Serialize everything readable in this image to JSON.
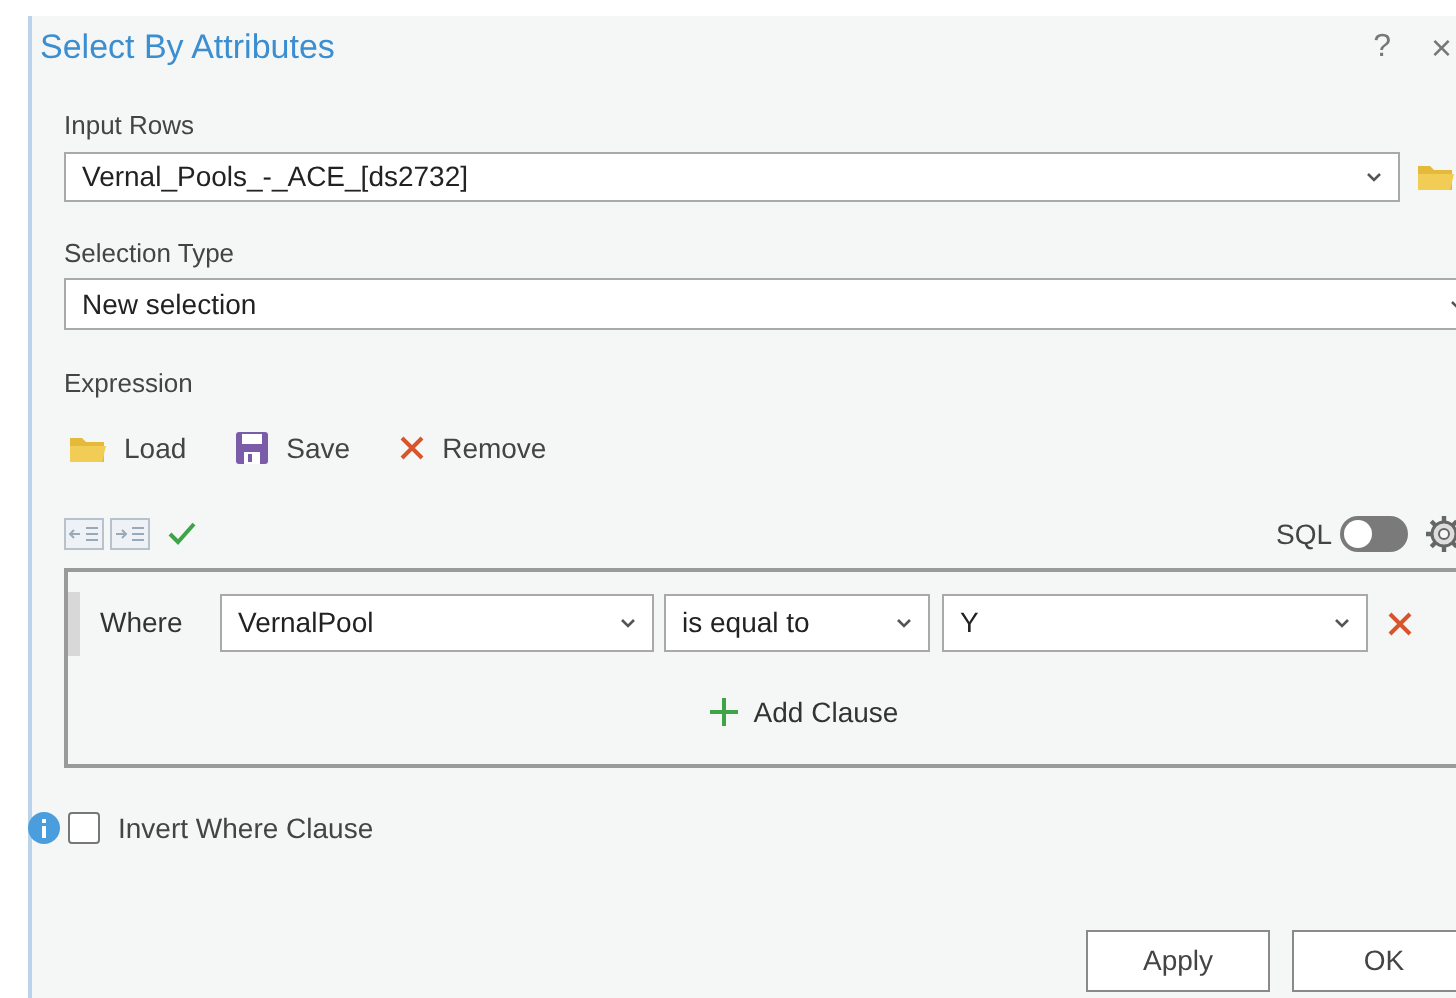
{
  "dialog": {
    "title": "Select By Attributes",
    "help": "?",
    "close": "×"
  },
  "input_rows": {
    "label": "Input Rows",
    "value": "Vernal_Pools_-_ACE_[ds2732]"
  },
  "selection_type": {
    "label": "Selection Type",
    "value": "New selection"
  },
  "expression": {
    "label": "Expression",
    "actions": [
      {
        "kind": "load",
        "label": "Load"
      },
      {
        "kind": "save",
        "label": "Save"
      },
      {
        "kind": "remove",
        "label": "Remove"
      }
    ],
    "sql": {
      "label": "SQL",
      "on": false
    },
    "clauses": [
      {
        "keyword": "Where",
        "field": "VernalPool",
        "operator": "is equal to",
        "value": "Y"
      }
    ],
    "add_clause": "Add Clause"
  },
  "invert": {
    "label": "Invert Where Clause",
    "checked": false
  },
  "buttons": [
    {
      "label": "Apply"
    },
    {
      "label": "OK"
    }
  ]
}
